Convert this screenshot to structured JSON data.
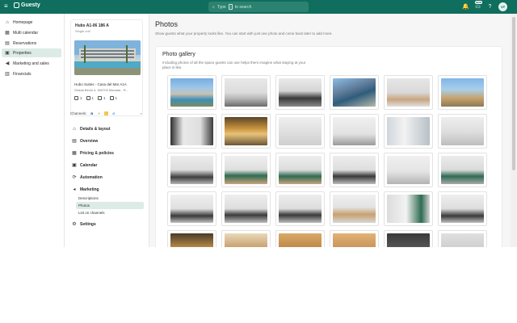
{
  "topbar": {
    "brand": "Guesty",
    "search_prefix": "Type",
    "search_key": "/",
    "search_suffix": "to search",
    "new_badge": "NEW",
    "avatar_initials": "VP"
  },
  "nav": {
    "items": [
      {
        "label": "Homepage",
        "icon": "home-icon"
      },
      {
        "label": "Multi calendar",
        "icon": "calendar-icon"
      },
      {
        "label": "Reservations",
        "icon": "reservations-icon"
      },
      {
        "label": "Properties",
        "icon": "properties-icon",
        "active": true
      },
      {
        "label": "Marketing and sales",
        "icon": "megaphone-icon"
      },
      {
        "label": "Financials",
        "icon": "financials-icon"
      }
    ]
  },
  "listing": {
    "title": "Hubs A1-06 186 A",
    "subtitle": "Single unit",
    "name": "Hubo Suites - Casa del Mar A1A",
    "address": "Strada Birchi 4, 905700 Mamaia - R...",
    "bedrooms": "1",
    "bathrooms": "1",
    "guests": "1",
    "rooms": "1",
    "channels_label": "Channels:"
  },
  "sections": [
    {
      "label": "Details & layout",
      "icon": "home-icon"
    },
    {
      "label": "Overview",
      "icon": "overview-icon"
    },
    {
      "label": "Pricing & policies",
      "icon": "pricing-icon"
    },
    {
      "label": "Calendar",
      "icon": "calendar-icon"
    },
    {
      "label": "Automation",
      "icon": "automation-icon"
    },
    {
      "label": "Marketing",
      "icon": "marketing-icon"
    },
    {
      "label": "Settings",
      "icon": "gear-icon"
    }
  ],
  "marketing_sub": [
    {
      "label": "Descriptions"
    },
    {
      "label": "Photos",
      "active": true
    },
    {
      "label": "List on channels"
    }
  ],
  "page": {
    "title": "Photos",
    "description": "Show guests what your property looks like. You can start with just one photo and come back later to add more."
  },
  "gallery": {
    "title": "Photo gallery",
    "description": "Including photos of all the space guests can use helps them imagine what staying at your place is like."
  },
  "colors": {
    "brand": "#0f6e5d",
    "active_bg": "#dcebe6"
  }
}
